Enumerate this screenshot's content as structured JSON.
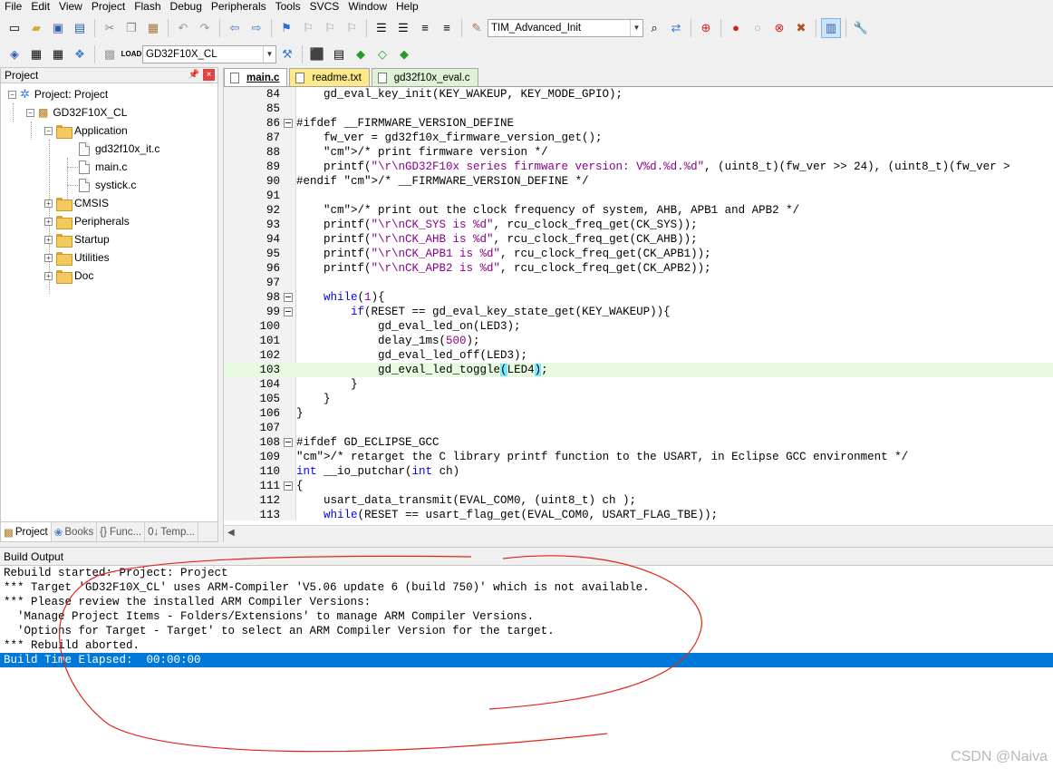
{
  "menu": [
    "File",
    "Edit",
    "View",
    "Project",
    "Flash",
    "Debug",
    "Peripherals",
    "Tools",
    "SVCS",
    "Window",
    "Help"
  ],
  "toolbar1": {
    "target_combo": "TIM_Advanced_Init"
  },
  "toolbar2": {
    "target_select": "GD32F10X_CL"
  },
  "project": {
    "title": "Project",
    "pin": "ᴾ",
    "close": "×",
    "root": "Project: Project",
    "target": "GD32F10X_CL",
    "groups": {
      "application": "Application",
      "cmsis": "CMSIS",
      "peripherals": "Peripherals",
      "startup": "Startup",
      "utilities": "Utilities",
      "doc": "Doc"
    },
    "files": [
      "gd32f10x_it.c",
      "main.c",
      "systick.c"
    ],
    "tabs": [
      "Project",
      "Books",
      "Func...",
      "Temp..."
    ]
  },
  "editor": {
    "tabs": [
      "main.c",
      "readme.txt",
      "gd32f10x_eval.c"
    ]
  },
  "code_lines": [
    {
      "n": "84",
      "t": "    gd_eval_key_init(KEY_WAKEUP, KEY_MODE_GPIO);"
    },
    {
      "n": "85",
      "t": ""
    },
    {
      "n": "86",
      "t": "#ifdef __FIRMWARE_VERSION_DEFINE"
    },
    {
      "n": "87",
      "t": "    fw_ver = gd32f10x_firmware_version_get();"
    },
    {
      "n": "88",
      "t": "    /* print firmware version */"
    },
    {
      "n": "89",
      "t": "    printf(\"\\r\\nGD32F10x series firmware version: V%d.%d.%d\", (uint8_t)(fw_ver >> 24), (uint8_t)(fw_ver >"
    },
    {
      "n": "90",
      "t": "#endif /* __FIRMWARE_VERSION_DEFINE */"
    },
    {
      "n": "91",
      "t": ""
    },
    {
      "n": "92",
      "t": "    /* print out the clock frequency of system, AHB, APB1 and APB2 */"
    },
    {
      "n": "93",
      "t": "    printf(\"\\r\\nCK_SYS is %d\", rcu_clock_freq_get(CK_SYS));"
    },
    {
      "n": "94",
      "t": "    printf(\"\\r\\nCK_AHB is %d\", rcu_clock_freq_get(CK_AHB));"
    },
    {
      "n": "95",
      "t": "    printf(\"\\r\\nCK_APB1 is %d\", rcu_clock_freq_get(CK_APB1));"
    },
    {
      "n": "96",
      "t": "    printf(\"\\r\\nCK_APB2 is %d\", rcu_clock_freq_get(CK_APB2));"
    },
    {
      "n": "97",
      "t": ""
    },
    {
      "n": "98",
      "t": "    while(1){"
    },
    {
      "n": "99",
      "t": "        if(RESET == gd_eval_key_state_get(KEY_WAKEUP)){"
    },
    {
      "n": "100",
      "t": "            gd_eval_led_on(LED3);"
    },
    {
      "n": "101",
      "t": "            delay_1ms(500);"
    },
    {
      "n": "102",
      "t": "            gd_eval_led_off(LED3);"
    },
    {
      "n": "103",
      "t": "            gd_eval_led_toggle(LED4);"
    },
    {
      "n": "104",
      "t": "        }"
    },
    {
      "n": "105",
      "t": "    }"
    },
    {
      "n": "106",
      "t": "}"
    },
    {
      "n": "107",
      "t": ""
    },
    {
      "n": "108",
      "t": "#ifdef GD_ECLIPSE_GCC"
    },
    {
      "n": "109",
      "t": "/* retarget the C library printf function to the USART, in Eclipse GCC environment */"
    },
    {
      "n": "110",
      "t": "int __io_putchar(int ch)"
    },
    {
      "n": "111",
      "t": "{"
    },
    {
      "n": "112",
      "t": "    usart_data_transmit(EVAL_COM0, (uint8_t) ch );"
    },
    {
      "n": "113",
      "t": "    while(RESET == usart_flag_get(EVAL_COM0, USART_FLAG_TBE));"
    }
  ],
  "output": {
    "title": "Build Output",
    "lines": [
      "Rebuild started: Project: Project",
      "*** Target 'GD32F10X_CL' uses ARM-Compiler 'V5.06 update 6 (build 750)' which is not available.",
      "*** Please review the installed ARM Compiler Versions:",
      "  'Manage Project Items - Folders/Extensions' to manage ARM Compiler Versions.",
      "  'Options for Target - Target' to select an ARM Compiler Version for the target.",
      "*** Rebuild aborted.",
      "Build Time Elapsed:  00:00:00"
    ]
  },
  "watermark": "CSDN @Naiva",
  "colors": {
    "selection": "#0078d7",
    "current_line": "#e6fbe0",
    "keyword": "#0000ff",
    "string": "#8b008b",
    "annotation": "#e0251b"
  }
}
